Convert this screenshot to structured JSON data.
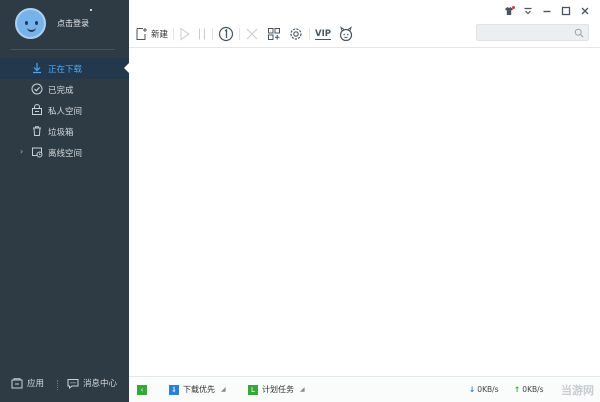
{
  "sidebar": {
    "login_label": "点击登录",
    "items": [
      {
        "label": "正在下载",
        "icon": "download-icon",
        "active": true
      },
      {
        "label": "已完成",
        "icon": "check-circle-icon",
        "active": false
      },
      {
        "label": "私人空间",
        "icon": "private-space-icon",
        "active": false
      },
      {
        "label": "垃圾箱",
        "icon": "trash-icon",
        "active": false
      },
      {
        "label": "离线空间",
        "icon": "offline-space-icon",
        "active": false,
        "expandable": true
      }
    ],
    "bottom": {
      "app_label": "应用",
      "message_label": "消息中心"
    }
  },
  "toolbar": {
    "new_label": "新建",
    "vip_label": "VIP"
  },
  "search": {
    "placeholder": ""
  },
  "statusbar": {
    "priority_label": "下载优先",
    "schedule_label": "计划任务",
    "download_speed": "0KB/s",
    "upload_speed": "0KB/s",
    "watermark": "当游网"
  },
  "colors": {
    "sidebar_bg": "#2f3b44",
    "active_text": "#4fa8ee",
    "accent_green": "#3aa53a",
    "accent_blue": "#2f7fd1"
  }
}
